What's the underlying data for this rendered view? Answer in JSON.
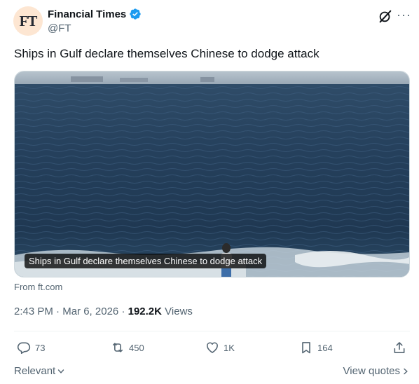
{
  "author": {
    "avatar_text": "FT",
    "display_name": "Financial Times",
    "handle": "@FT",
    "verified": true,
    "verified_color": "#1d9bf0",
    "avatar_bg": "#fde6d2"
  },
  "header_icons": {
    "grok": "grok-icon",
    "more": "···"
  },
  "tweet": {
    "text": "Ships in Gulf declare themselves Chinese to dodge attack",
    "card_caption": "Ships in Gulf declare themselves Chinese to dodge attack",
    "card_source": "From ft.com",
    "time": "2:43 PM",
    "date": "Mar 6, 2026",
    "separator": "·",
    "views_count": "192.2K",
    "views_label": "Views"
  },
  "actions": {
    "replies": "73",
    "reposts": "450",
    "likes": "1K",
    "bookmarks": "164"
  },
  "footer": {
    "sort_label": "Relevant",
    "view_quotes_label": "View quotes"
  },
  "colors": {
    "secondary_text": "#536471",
    "primary_text": "#0f1419",
    "sea_dark": "#1e3a56",
    "sea_light": "#3a5e80"
  }
}
